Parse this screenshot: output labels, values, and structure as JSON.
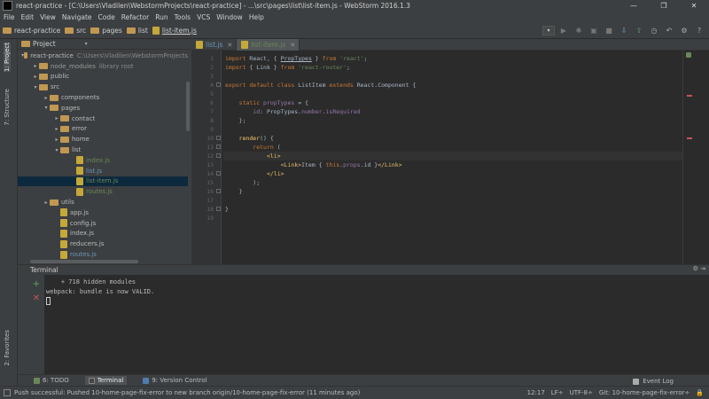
{
  "window": {
    "title": "react-practice - [C:\\Users\\Vladilen\\WebstormProjects\\react-practice] - ...\\src\\pages\\list\\list-item.js - WebStorm 2016.1.3",
    "controls": [
      "—",
      "❐",
      "✕"
    ]
  },
  "menu": [
    "File",
    "Edit",
    "View",
    "Navigate",
    "Code",
    "Refactor",
    "Run",
    "Tools",
    "VCS",
    "Window",
    "Help"
  ],
  "breadcrumbs": [
    "react-practice",
    "src",
    "pages",
    "list",
    "list-item.js"
  ],
  "left_strip": {
    "project": "1: Project",
    "structure": "7: Structure",
    "favorites": "2: Favorites"
  },
  "project_panel": {
    "title": "Project",
    "tree": [
      {
        "label": "react-practice",
        "hint": "C:\\Users\\Vladilen\\WebstormProjects",
        "type": "folder",
        "arrow": "▾"
      },
      {
        "label": "node_modules",
        "hint": "library root",
        "type": "folder",
        "arrow": "▸"
      },
      {
        "label": "public",
        "type": "folder",
        "arrow": "▸"
      },
      {
        "label": "src",
        "type": "folder",
        "arrow": "▾"
      },
      {
        "label": "components",
        "type": "folder",
        "arrow": "▸"
      },
      {
        "label": "pages",
        "type": "folder",
        "arrow": "▾"
      },
      {
        "label": "contact",
        "type": "folder",
        "arrow": "▸"
      },
      {
        "label": "error",
        "type": "folder",
        "arrow": "▸"
      },
      {
        "label": "home",
        "type": "folder",
        "arrow": "▸"
      },
      {
        "label": "list",
        "type": "folder",
        "arrow": "▾"
      },
      {
        "label": "index.js",
        "type": "file",
        "color": "green"
      },
      {
        "label": "list.js",
        "type": "file",
        "color": "blue"
      },
      {
        "label": "list-item.js",
        "type": "file",
        "color": "green"
      },
      {
        "label": "routes.js",
        "type": "file",
        "color": "green"
      },
      {
        "label": "utils",
        "type": "folder",
        "arrow": "▸"
      },
      {
        "label": "app.js",
        "type": "file",
        "color": "plain"
      },
      {
        "label": "config.js",
        "type": "file",
        "color": "plain"
      },
      {
        "label": "index.js",
        "type": "file",
        "color": "plain"
      },
      {
        "label": "reducers.js",
        "type": "file",
        "color": "plain"
      },
      {
        "label": "routes.js",
        "type": "file",
        "color": "blue"
      }
    ]
  },
  "editor": {
    "tabs": [
      {
        "label": "list.js",
        "active": false
      },
      {
        "label": "list-item.js",
        "active": true
      }
    ],
    "line_numbers": [
      "1",
      "2",
      "3",
      "4",
      "5",
      "6",
      "7",
      "8",
      "9",
      "10",
      "11",
      "12",
      "13",
      "14",
      "15",
      "16",
      "17",
      "18",
      "19"
    ],
    "code": [
      [
        [
          "kw",
          "import "
        ],
        [
          "",
          "React, { "
        ],
        [
          "u",
          "PropTypes"
        ],
        [
          "",
          " } "
        ],
        [
          "kw",
          "from "
        ],
        [
          "str",
          "'react'"
        ],
        [
          "",
          ";"
        ]
      ],
      [
        [
          "kw",
          "import "
        ],
        [
          "",
          "{ Link } "
        ],
        [
          "kw",
          "from "
        ],
        [
          "str",
          "'react-router'"
        ],
        [
          "",
          ";"
        ]
      ],
      [],
      [
        [
          "kw",
          "export default class "
        ],
        [
          "",
          "ListItem "
        ],
        [
          "kw",
          "extends "
        ],
        [
          "",
          "React.Component {"
        ]
      ],
      [],
      [
        [
          "kw",
          "    static "
        ],
        [
          "prop",
          "propTypes"
        ],
        [
          "",
          " = {"
        ]
      ],
      [
        [
          "prop",
          "        id"
        ],
        [
          "",
          ": PropTypes."
        ],
        [
          "prop",
          "number"
        ],
        [
          "",
          "."
        ],
        [
          "prop",
          "isRequired"
        ]
      ],
      [
        [
          "",
          "    };"
        ]
      ],
      [],
      [
        [
          "fn",
          "    render"
        ],
        [
          "",
          "() {"
        ]
      ],
      [
        [
          "kw",
          "        return "
        ],
        [
          "",
          "("
        ]
      ],
      [
        [
          "tag",
          "            <li>"
        ]
      ],
      [
        [
          "tag",
          "                <Link>"
        ],
        [
          "",
          "Item { "
        ],
        [
          "kw",
          "this"
        ],
        [
          "",
          "."
        ],
        [
          "prop",
          "props"
        ],
        [
          "",
          ".id }"
        ],
        [
          "tag",
          "</Link>"
        ]
      ],
      [
        [
          "tag",
          "            </li>"
        ]
      ],
      [
        [
          "",
          "        );"
        ]
      ],
      [
        [
          "",
          "    }"
        ]
      ],
      [],
      [
        [
          "",
          "}"
        ]
      ],
      []
    ]
  },
  "terminal": {
    "title": "Terminal",
    "lines": [
      "    + 718 hidden modules",
      "webpack: bundle is now VALID."
    ]
  },
  "bottom_tabs": [
    "6: TODO",
    "Terminal",
    "9: Version Control"
  ],
  "event_log": "Event Log",
  "status": {
    "message": "Push successful: Pushed 10-home-page-fix-error to new branch origin/10-home-page-fix-error (11 minutes ago)",
    "position": "12:17",
    "line_sep": "LF÷",
    "encoding": "UTF-8÷",
    "branch": "Git: 10-home-page-fix-error÷"
  },
  "colors": {
    "accent_green": "#499c54",
    "accent_red": "#c75450",
    "folder": "#c09853"
  }
}
